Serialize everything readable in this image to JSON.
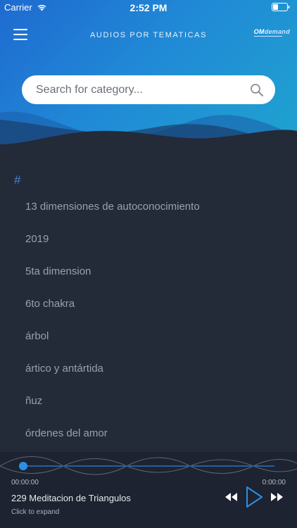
{
  "status_bar": {
    "carrier": "Carrier",
    "time": "2:52 PM"
  },
  "header": {
    "title": "AUDIOS POR TEMATICAS",
    "logo_om": "OM",
    "logo_rest": "demand"
  },
  "search": {
    "placeholder": "Search for category..."
  },
  "list": {
    "section": "#",
    "items": [
      "13 dimensiones de autoconocimiento",
      "2019",
      "5ta dimension",
      "6to chakra",
      "árbol",
      "ártico y antártida",
      "ñuz",
      "órdenes del amor"
    ]
  },
  "player": {
    "time_start": "00:00:00",
    "time_end": "0:00:00",
    "track_title": "229 Meditacion de Triangulos",
    "hint": "Click to expand",
    "progress": 0
  },
  "colors": {
    "accent": "#2b8fe6",
    "background": "#232a38",
    "header_start": "#1f6ad0",
    "header_end": "#1fa4cf"
  },
  "icons": {
    "menu": "hamburger-icon",
    "search": "search-icon",
    "rewind": "rewind-icon",
    "play": "play-icon",
    "fast_forward": "fast-forward-icon",
    "wifi": "wifi-icon",
    "battery": "battery-icon"
  }
}
